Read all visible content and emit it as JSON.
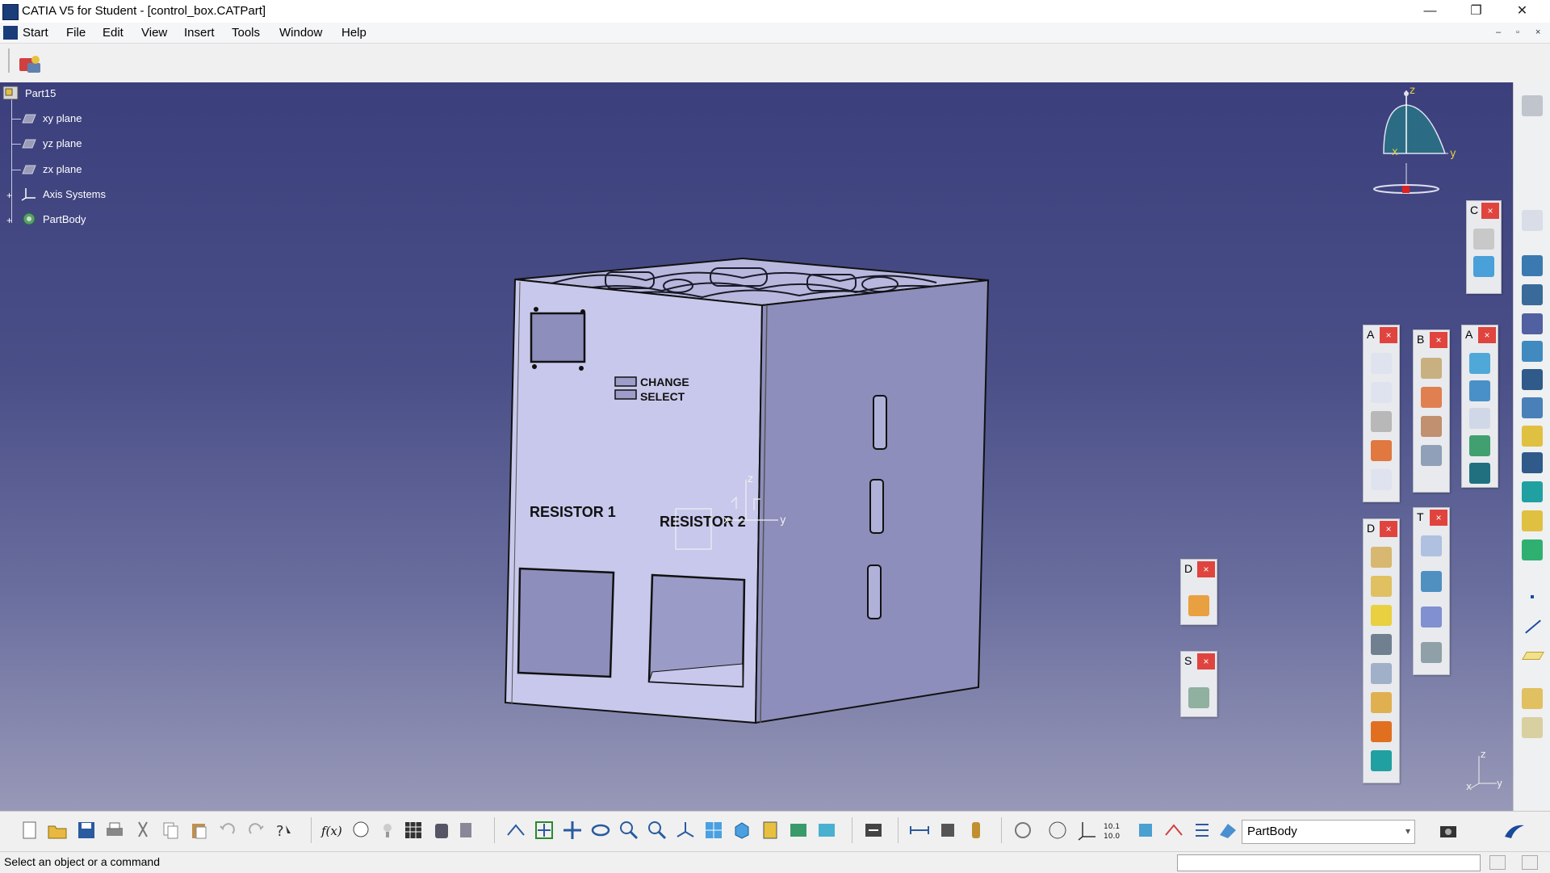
{
  "window": {
    "title": "CATIA V5 for Student - [control_box.CATPart]",
    "minimize_glyph": "—",
    "restore_glyph": "❐",
    "close_glyph": "✕"
  },
  "menu": {
    "items": [
      "Start",
      "File",
      "Edit",
      "View",
      "Insert",
      "Tools",
      "Window",
      "Help"
    ]
  },
  "tree": {
    "root": "Part15",
    "items": [
      {
        "label": "xy plane",
        "icon": "plane-icon"
      },
      {
        "label": "yz plane",
        "icon": "plane-icon"
      },
      {
        "label": "zx plane",
        "icon": "plane-icon"
      },
      {
        "label": "Axis Systems",
        "icon": "axis-system-icon"
      },
      {
        "label": "PartBody",
        "icon": "partbody-gear-icon"
      }
    ]
  },
  "model": {
    "label_change": "CHANGE",
    "label_select": "SELECT",
    "label_resistor1": "RESISTOR 1",
    "label_resistor2": "RESISTOR 2"
  },
  "axes": {
    "x": "x",
    "y": "y",
    "z": "z"
  },
  "panels": [
    {
      "label": "C",
      "close": "×"
    },
    {
      "label": "A",
      "close": "×"
    },
    {
      "label": "B",
      "close": "×"
    },
    {
      "label": "A",
      "close": "×"
    },
    {
      "label": "D",
      "close": "×"
    },
    {
      "label": "T",
      "close": "×"
    },
    {
      "label": "D",
      "close": "×"
    },
    {
      "label": "S",
      "close": "×"
    }
  ],
  "bottom": {
    "body_select": "PartBody",
    "fx_label": "f(x)",
    "ratio_label": "10.1 10.0"
  },
  "status": {
    "message": "Select an object or a command"
  },
  "colors": {
    "viewport_top": "#3b3f7c",
    "viewport_bottom": "#9899b8",
    "part_face": "#c8c8ec",
    "part_side": "#9fa0cc",
    "panel_close": "#e0443e"
  }
}
